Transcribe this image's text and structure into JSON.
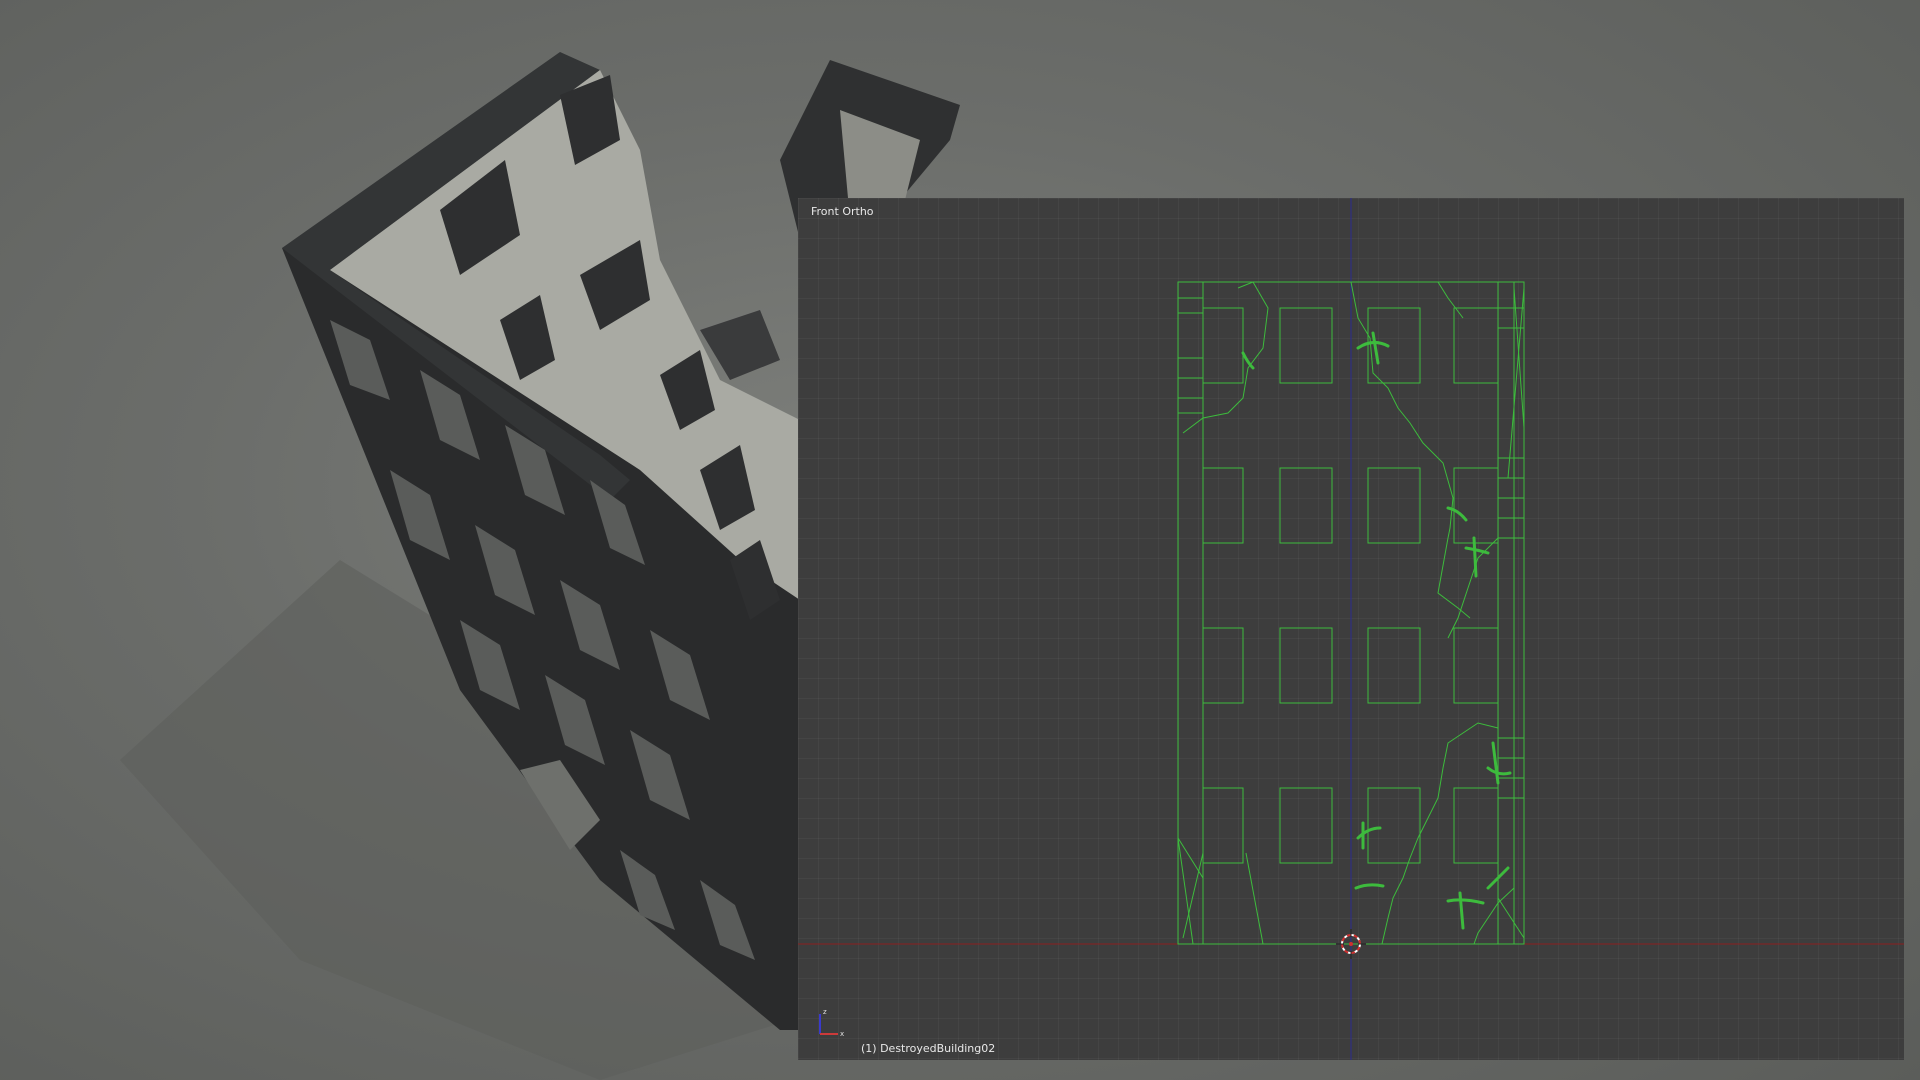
{
  "viewport": {
    "view_name": "Front Ortho",
    "active_object": "(1) DestroyedBuilding02"
  },
  "gizmo": {
    "axis_z": "z",
    "axis_x": "x"
  },
  "colors": {
    "viewport_bg": "#3d3d3d",
    "wireframe": "#3dbb3d",
    "x_axis": "#8a2020",
    "z_axis": "#2a2a90"
  }
}
